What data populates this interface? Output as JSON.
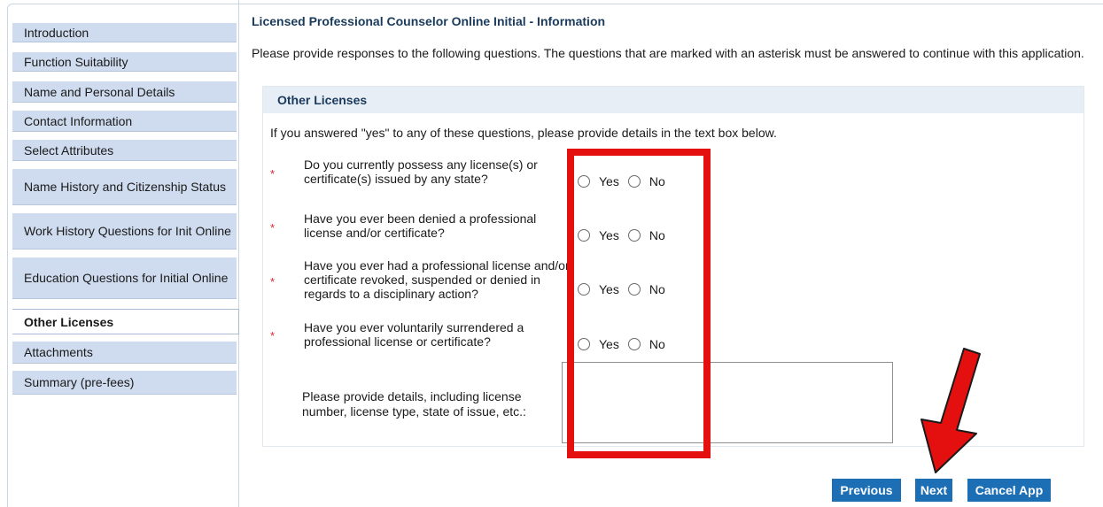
{
  "sidebar": {
    "items": [
      {
        "label": "Introduction"
      },
      {
        "label": "Function Suitability"
      },
      {
        "label": "Name and Personal Details"
      },
      {
        "label": "Contact Information"
      },
      {
        "label": "Select Attributes"
      },
      {
        "label": "Name History and Citizenship Status"
      },
      {
        "label": "Work History Questions for Init Online"
      },
      {
        "label": "Education Questions for Initial Online"
      },
      {
        "label": "Other Licenses",
        "active": true
      },
      {
        "label": "Attachments"
      },
      {
        "label": "Summary (pre-fees)"
      }
    ]
  },
  "main": {
    "title": "Licensed Professional Counselor Online Initial - Information",
    "intro": "Please provide responses to the following questions. The questions that are marked with an asterisk must be answered to continue with this application.",
    "section": {
      "title": "Other Licenses",
      "note": "If you answered \"yes\" to any of these questions, please provide details in the text box below.",
      "questions": [
        {
          "text": "Do you currently possess any license(s) or certificate(s) issued by any state?",
          "required": "*"
        },
        {
          "text": "Have you ever been denied a professional license and/or certificate?",
          "required": "*"
        },
        {
          "text": "Have you ever had a professional license and/or certificate revoked, suspended or denied in regards to a disciplinary action?",
          "required": "*"
        },
        {
          "text": "Have you ever voluntarily surrendered a professional license or certificate?",
          "required": "*"
        }
      ],
      "yes_label": "Yes",
      "no_label": "No",
      "details_label": "Please provide details, including license number, license type, state of issue, etc.:",
      "details_value": ""
    }
  },
  "buttons": {
    "previous": "Previous",
    "next": "Next",
    "cancel": "Cancel App"
  },
  "colors": {
    "annotation": "#e41010",
    "button": "#1d6fb5",
    "sidebar": "#cfdcef"
  }
}
